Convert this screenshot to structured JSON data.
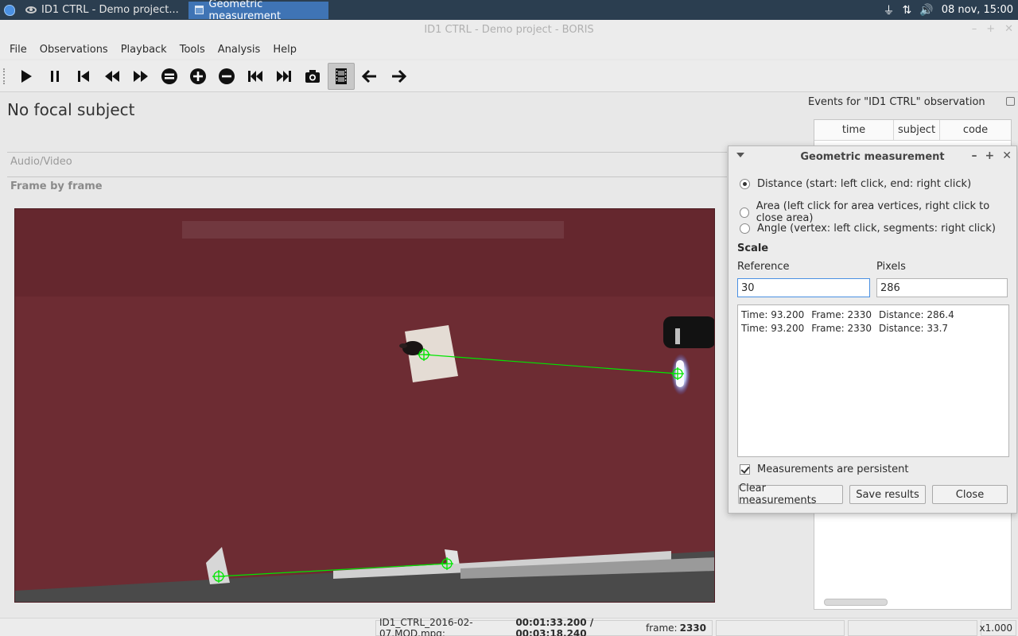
{
  "taskbar": {
    "tasks": [
      {
        "label": "ID1 CTRL - Demo project...",
        "active": false
      },
      {
        "label": "Geometric measurement",
        "active": true
      }
    ],
    "clock": "08 nov, 15:00"
  },
  "window": {
    "title": "ID1 CTRL - Demo project - BORIS"
  },
  "menu": {
    "items": [
      "File",
      "Observations",
      "Playback",
      "Tools",
      "Analysis",
      "Help"
    ]
  },
  "toolbar": {
    "icons": [
      "play-icon",
      "pause-icon",
      "skip-back-icon",
      "rewind-icon",
      "fast-forward-icon",
      "equal-icon",
      "plus-icon",
      "minus-icon",
      "first-frame-icon",
      "last-frame-icon",
      "camera-icon",
      "film-icon",
      "arrow-left-icon",
      "arrow-right-icon"
    ]
  },
  "main": {
    "focal_subject": "No focal subject",
    "av_label": "Audio/Video",
    "fbf_label": "Frame by frame"
  },
  "events": {
    "title": "Events for \"ID1 CTRL\" observation",
    "columns": [
      "time",
      "subject",
      "code"
    ]
  },
  "dialog": {
    "title": "Geometric measurement",
    "modes": [
      {
        "label": "Distance (start: left click, end: right click)",
        "selected": true
      },
      {
        "label": "Area (left click for area vertices, right click to close area)",
        "selected": false
      },
      {
        "label": "Angle (vertex: left click, segments: right click)",
        "selected": false
      }
    ],
    "scale_label": "Scale",
    "reference_label": "Reference",
    "pixels_label": "Pixels",
    "reference_value": "30",
    "pixels_value": "286",
    "results": [
      {
        "time": "Time: 93.200",
        "frame": "Frame: 2330",
        "distance": "Distance: 286.4"
      },
      {
        "time": "Time: 93.200",
        "frame": "Frame: 2330",
        "distance": "Distance: 33.7"
      }
    ],
    "persistent_label": "Measurements are persistent",
    "persistent_checked": true,
    "clear_label": "Clear measurements",
    "save_label": "Save results",
    "close_label": "Close"
  },
  "status": {
    "file": "ID1_CTRL_2016-02-07.MOD.mpg:",
    "time": "00:01:33.200 / 00:03:18.240",
    "frame_label": "frame:",
    "frame": "2330",
    "speed": "x1.000"
  },
  "colors": {
    "taskbar_bg": "#2b3e50",
    "active_task": "#3f74b5",
    "measure_line": "#00e600",
    "video_bg": "#6e2d34"
  }
}
